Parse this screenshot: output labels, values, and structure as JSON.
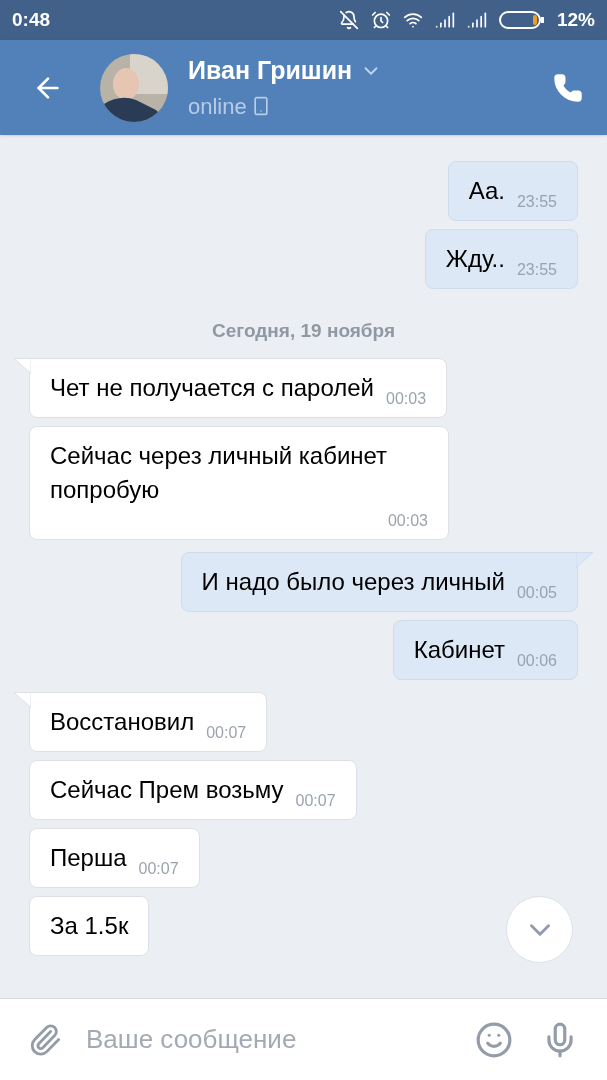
{
  "status_bar": {
    "time": "0:48",
    "battery": "12%"
  },
  "header": {
    "name": "Иван Гришин",
    "status": "online"
  },
  "messages": [
    {
      "kind": "out",
      "text": "Аа.",
      "time": "23:55",
      "tail": false
    },
    {
      "kind": "out",
      "text": "Жду..",
      "time": "23:55",
      "tail": false
    },
    {
      "kind": "date",
      "text": "Сегодня, 19 ноября"
    },
    {
      "kind": "in",
      "text": "Чет не получается с паролей",
      "time": "00:03",
      "tail": true
    },
    {
      "kind": "in",
      "text": "Сейчас через личный кабинет попробую",
      "time": "00:03",
      "tail": false
    },
    {
      "kind": "out",
      "text": "И надо было через личный",
      "time": "00:05",
      "tail": true
    },
    {
      "kind": "out",
      "text": "Кабинет",
      "time": "00:06",
      "tail": false
    },
    {
      "kind": "in",
      "text": "Восстановил",
      "time": "00:07",
      "tail": true
    },
    {
      "kind": "in",
      "text": "Сейчас Прем возьму",
      "time": "00:07",
      "tail": false
    },
    {
      "kind": "in",
      "text": "Перша",
      "time": "00:07",
      "tail": false
    },
    {
      "kind": "in",
      "text": "За 1.5к",
      "tail": false
    }
  ],
  "composer": {
    "placeholder": "Ваше сообщение"
  }
}
